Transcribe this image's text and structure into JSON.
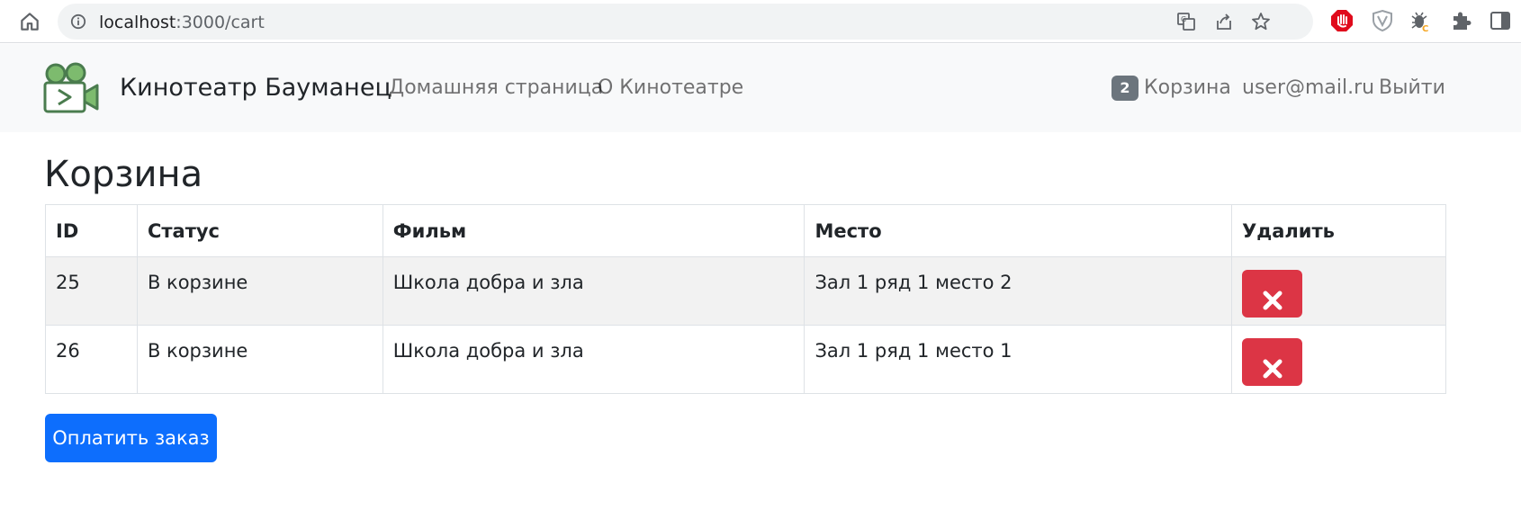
{
  "browser": {
    "url_host": "localhost",
    "url_path": ":3000/cart"
  },
  "navbar": {
    "brand": "Кинотеатр Бауманец",
    "links": [
      "Домашняя страница",
      "О Кинотеатре"
    ],
    "cart_count": "2",
    "cart_label": "Корзина",
    "user_email": "user@mail.ru",
    "logout_label": "Выйти"
  },
  "page": {
    "title": "Корзина",
    "columns": [
      "ID",
      "Статус",
      "Фильм",
      "Место",
      "Удалить"
    ],
    "rows": [
      {
        "id": "25",
        "status": "В корзине",
        "film": "Школа добра и зла",
        "seat": "Зал 1 ряд 1 место 2"
      },
      {
        "id": "26",
        "status": "В корзине",
        "film": "Школа добра и зла",
        "seat": "Зал 1 ряд 1 место 1"
      }
    ],
    "pay_button": "Оплатить заказ"
  },
  "colors": {
    "danger": "#dc3545",
    "primary": "#0d6efd",
    "badge": "#6c757d",
    "logo": "#4a7c4e"
  }
}
